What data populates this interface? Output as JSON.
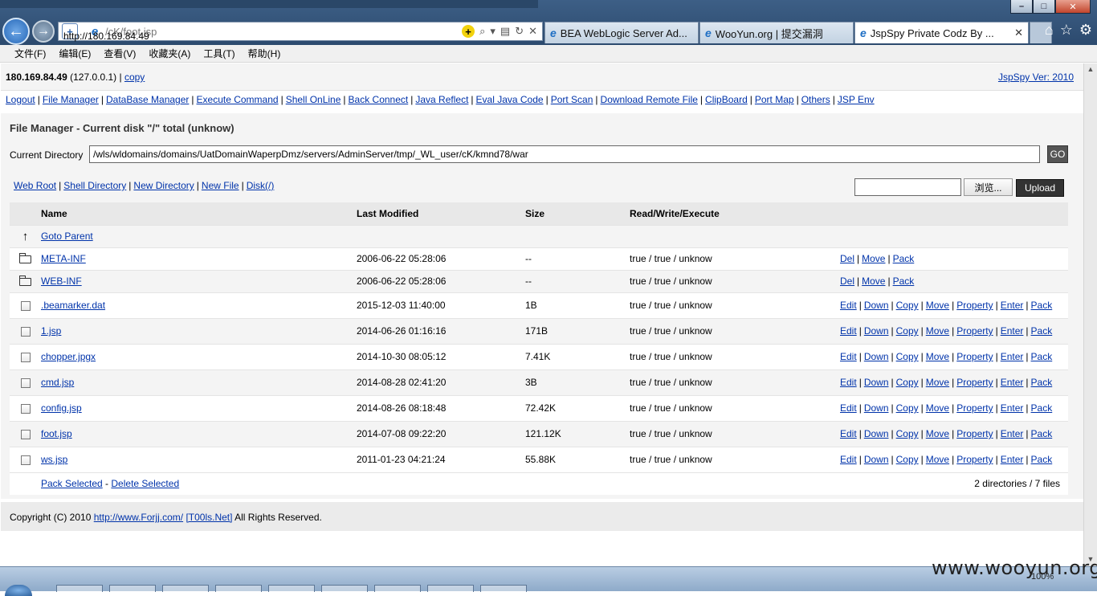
{
  "browser": {
    "address": {
      "host": "http://180.169.84.49",
      "path": "/cK/foot.jsp"
    },
    "tabs": [
      {
        "label": "BEA WebLogic Server Ad..."
      },
      {
        "label": "WooYun.org | 提交漏洞"
      },
      {
        "label": "JspSpy Private Codz By ..."
      }
    ],
    "menu": [
      "文件(F)",
      "编辑(E)",
      "查看(V)",
      "收藏夹(A)",
      "工具(T)",
      "帮助(H)"
    ]
  },
  "header": {
    "host_ip": "180.169.84.49",
    "local_ip": "(127.0.0.1)",
    "copy_label": "copy",
    "version_label": "JspSpy Ver: 2010"
  },
  "nav": [
    "Logout",
    "File Manager",
    "DataBase Manager",
    "Execute Command",
    "Shell OnLine",
    "Back Connect",
    "Java Reflect",
    "Eval Java Code",
    "Port Scan",
    "Download Remote File",
    "ClipBoard",
    "Port Map",
    "Others",
    "JSP Env"
  ],
  "file_manager": {
    "title": "File Manager - Current disk \"/\" total (unknow)",
    "current_dir_label": "Current Directory",
    "current_dir_value": "/wls/wldomains/domains/UatDomainWaperpDmz/servers/AdminServer/tmp/_WL_user/cK/kmnd78/war",
    "go_label": "GO",
    "toolbar_links": [
      "Web Root",
      "Shell Directory",
      "New Directory",
      "New File",
      "Disk(/)"
    ],
    "browse_label": "浏览...",
    "upload_label": "Upload",
    "columns": {
      "name": "Name",
      "modified": "Last Modified",
      "size": "Size",
      "rwx": "Read/Write/Execute"
    },
    "goto_parent": "Goto Parent",
    "dirs": [
      {
        "name": "META-INF",
        "modified": "2006-06-22 05:28:06",
        "size": "--",
        "rwx": "true / true / unknow"
      },
      {
        "name": "WEB-INF",
        "modified": "2006-06-22 05:28:06",
        "size": "--",
        "rwx": "true / true / unknow"
      }
    ],
    "dir_actions": [
      "Del",
      "Move",
      "Pack"
    ],
    "files": [
      {
        "name": ".beamarker.dat",
        "modified": "2015-12-03 11:40:00",
        "size": "1B",
        "rwx": "true / true / unknow"
      },
      {
        "name": "1.jsp",
        "modified": "2014-06-26 01:16:16",
        "size": "171B",
        "rwx": "true / true / unknow"
      },
      {
        "name": "chopper.jpgx",
        "modified": "2014-10-30 08:05:12",
        "size": "7.41K",
        "rwx": "true / true / unknow"
      },
      {
        "name": "cmd.jsp",
        "modified": "2014-08-28 02:41:20",
        "size": "3B",
        "rwx": "true / true / unknow"
      },
      {
        "name": "config.jsp",
        "modified": "2014-08-26 08:18:48",
        "size": "72.42K",
        "rwx": "true / true / unknow"
      },
      {
        "name": "foot.jsp",
        "modified": "2014-07-08 09:22:20",
        "size": "121.12K",
        "rwx": "true / true / unknow"
      },
      {
        "name": "ws.jsp",
        "modified": "2011-01-23 04:21:24",
        "size": "55.88K",
        "rwx": "true / true / unknow"
      }
    ],
    "file_actions": [
      "Edit",
      "Down",
      "Copy",
      "Move",
      "Property",
      "Enter",
      "Pack"
    ],
    "pack_selected": "Pack Selected",
    "delete_selected": "Delete Selected",
    "summary": "2 directories / 7 files"
  },
  "footer": {
    "prefix": "Copyright (C) 2010",
    "link1": "http://www.Forjj.com/",
    "link2": "[T00ls.Net]",
    "suffix": "All Rights Reserved."
  },
  "watermark": "www.wooyun.org",
  "zoom": "100%"
}
